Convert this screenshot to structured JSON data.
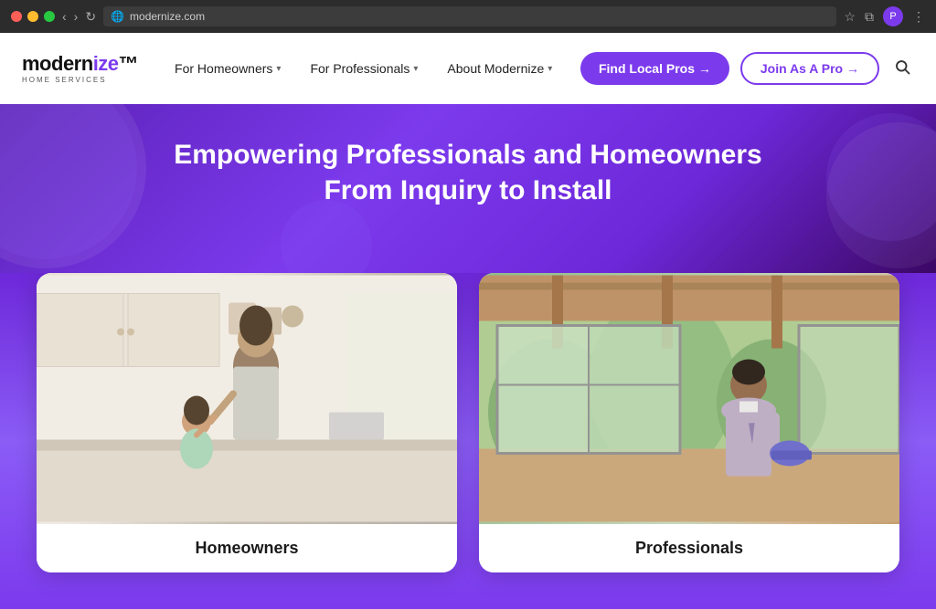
{
  "browser": {
    "url": "modernize.com",
    "favicon": "🌐"
  },
  "navbar": {
    "logo": {
      "text_pre": "modern",
      "text_ize": "ize",
      "subtext": "HOME SERVICES"
    },
    "links": [
      {
        "id": "for-homeowners",
        "label": "For Homeowners",
        "hasDropdown": true
      },
      {
        "id": "for-professionals",
        "label": "For Professionals",
        "hasDropdown": true
      },
      {
        "id": "about-modernize",
        "label": "About Modernize",
        "hasDropdown": true
      }
    ],
    "cta_find": "Find Local Pros →",
    "cta_join": "Join As A Pro →"
  },
  "hero": {
    "title": "Empowering Professionals and Homeowners From Inquiry to Install"
  },
  "cards": [
    {
      "id": "homeowners",
      "label": "Homeowners"
    },
    {
      "id": "professionals",
      "label": "Professionals"
    }
  ]
}
